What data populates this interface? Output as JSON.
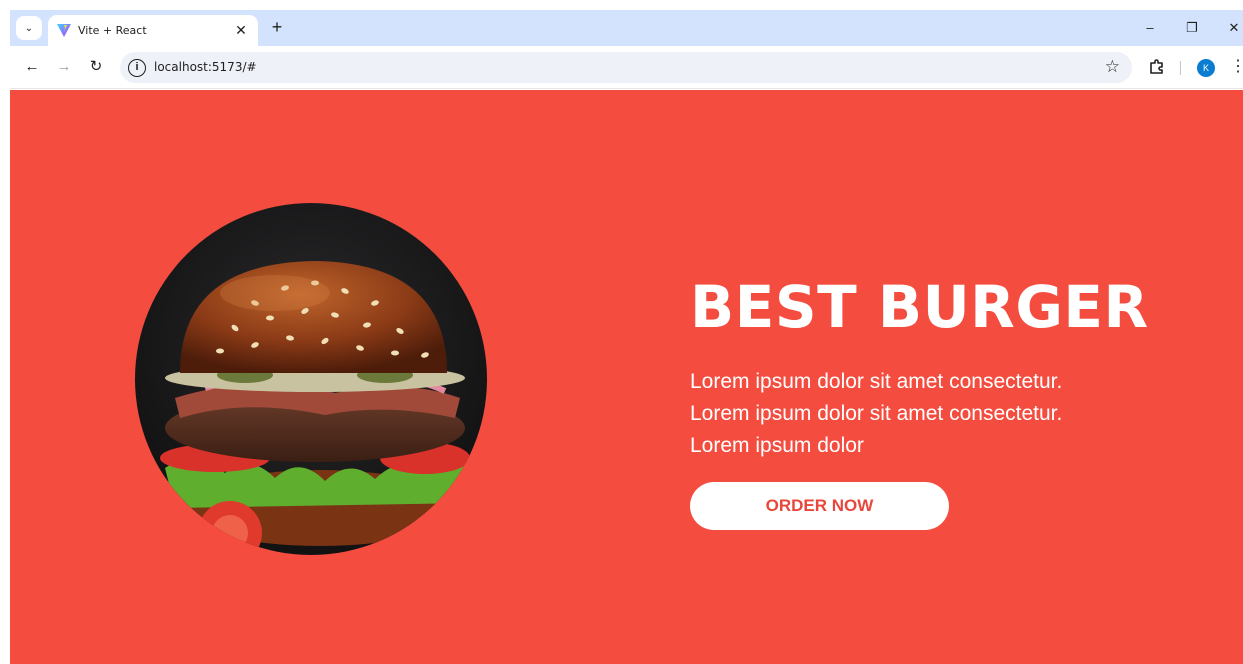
{
  "browser": {
    "tab_title": "Vite + React",
    "tab_close": "✕",
    "new_tab": "+",
    "tab_search": "⌄",
    "url": "localhost:5173/#",
    "controls": {
      "minimize": "–",
      "restore": "❐",
      "close": "✕"
    },
    "avatar_initial": "K",
    "icons": {
      "back": "←",
      "forward": "→",
      "reload": "↻",
      "info": "i",
      "star": "☆",
      "menu": "⋮"
    }
  },
  "hero": {
    "title": "BEST BURGER",
    "description": "Lorem ipsum dolor sit amet consectetur. Lorem ipsum dolor sit amet consectetur. Lorem ipsum dolor",
    "button_label": "ORDER NOW"
  },
  "colors": {
    "background": "#f44d3f",
    "button_text": "#e8483b",
    "tabstrip": "#d3e3fd",
    "avatar": "#0b7dd1"
  }
}
